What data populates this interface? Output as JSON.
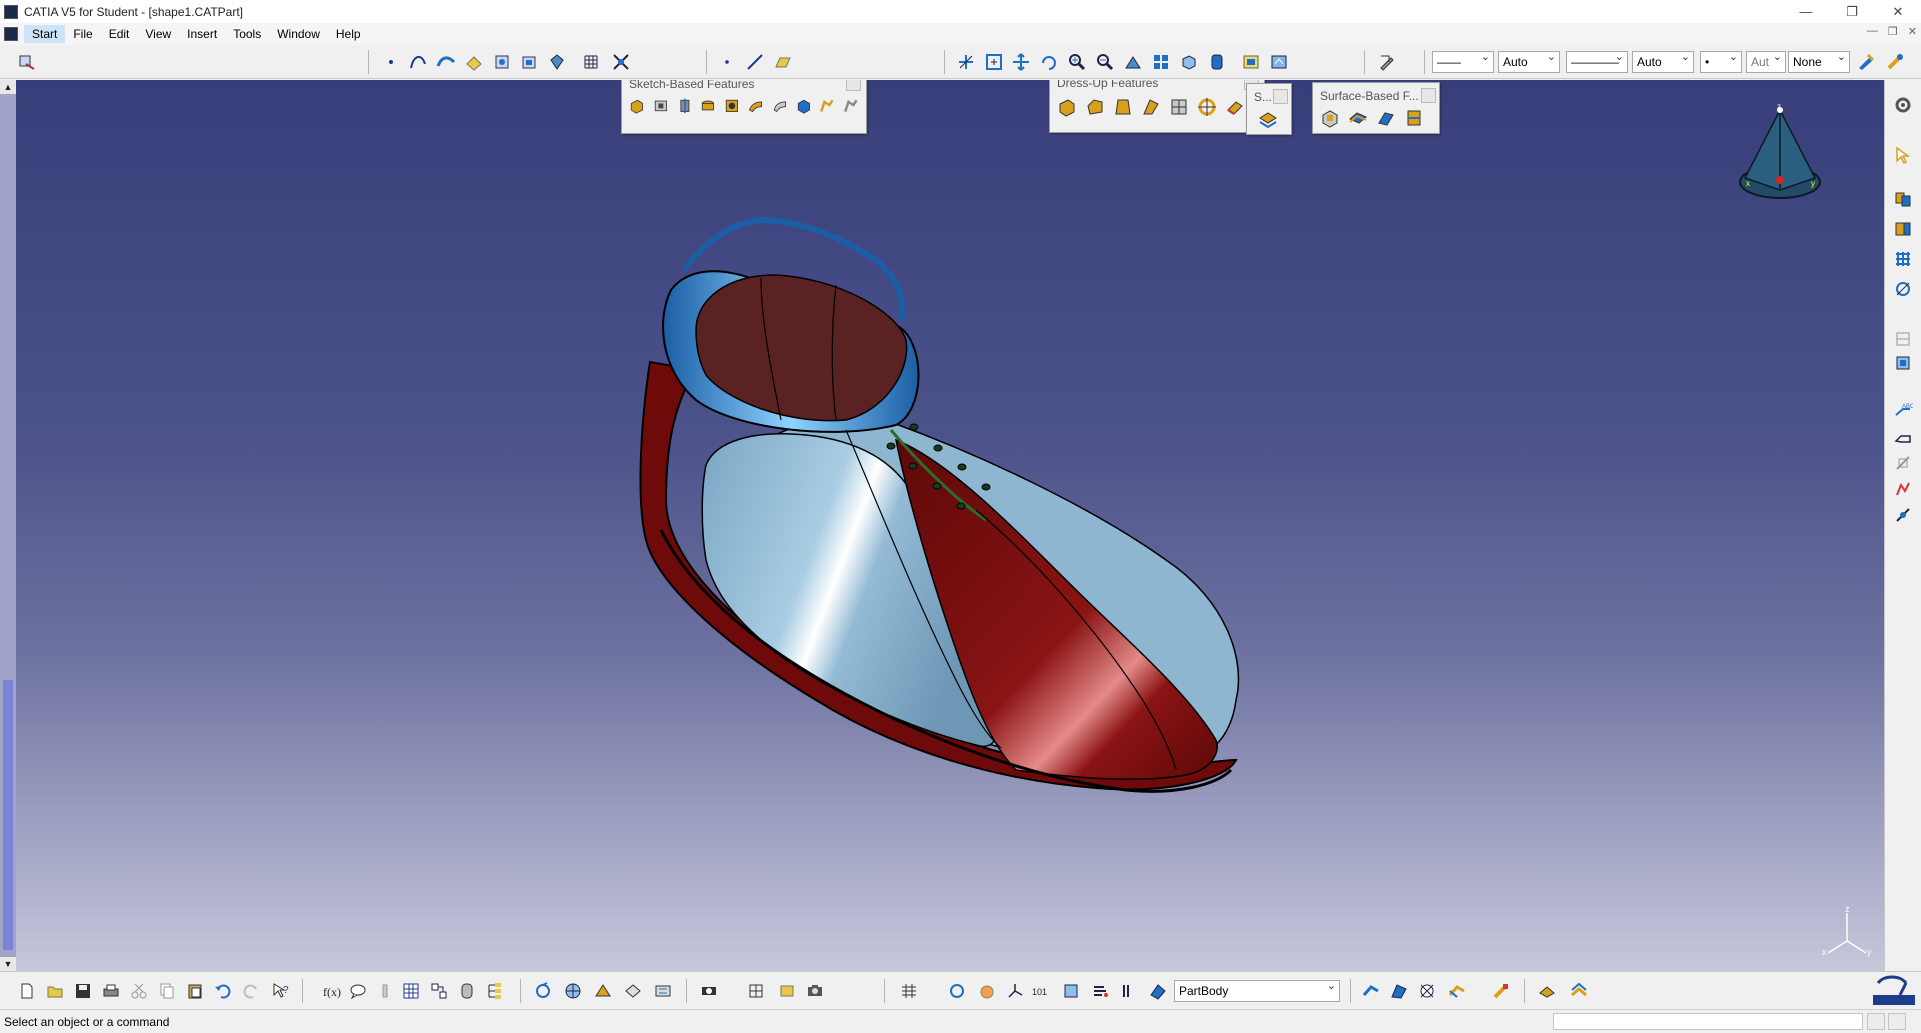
{
  "window": {
    "title": "CATIA V5 for Student - [shape1.CATPart]",
    "controls": [
      "—",
      "❐",
      "✕"
    ]
  },
  "menubar": {
    "items": [
      "Start",
      "File",
      "Edit",
      "View",
      "Insert",
      "Tools",
      "Window",
      "Help"
    ],
    "doc_controls": [
      "—",
      "❐",
      "✕"
    ]
  },
  "properties_toolbar": {
    "linetype_value": "——",
    "thickness_value": "Auto",
    "line_value": "————",
    "layer_value": "Auto",
    "point_value": "•",
    "aux_value": "Aut",
    "render_value": "None"
  },
  "floating_toolbars": {
    "sketch_based": {
      "title": "Sketch-Based Features"
    },
    "dress_up": {
      "title": "Dress-Up Features"
    },
    "s_small": {
      "title": "S..."
    },
    "surface_based": {
      "title": "Surface-Based F..."
    }
  },
  "compass": {
    "axes": [
      "x",
      "y",
      "z"
    ]
  },
  "axis_triad": {
    "labels": [
      "z",
      "x",
      "y"
    ]
  },
  "bottom_toolbar": {
    "body_selector_value": "PartBody"
  },
  "status": {
    "message": "Select an object or a command"
  },
  "colors": {
    "viewport_top": "#383e79",
    "viewport_bottom": "#c6c7db",
    "shoe_red": "#7a0d0d",
    "shoe_light_blue": "#8fb6d0",
    "shoe_collar_blue": "#2a86d2",
    "shoe_inner": "#5a2222"
  },
  "icons": {
    "top_toolbar": [
      "sketcher-icon",
      "point-icon",
      "spline-icon",
      "connect-curve-icon",
      "projection-icon",
      "3d-intersection-icon",
      "offset-icon",
      "compass-icon",
      "grid-icon",
      "snap-icon",
      "point-small-icon",
      "line-icon",
      "plane-icon",
      "fly-mode-icon",
      "fit-all-icon",
      "pan-icon",
      "rotate-icon",
      "zoom-in-icon",
      "zoom-out-icon",
      "normal-view-icon",
      "multi-view-icon",
      "iso-view-icon",
      "shading-icon",
      "hide-show-icon",
      "swap-space-icon",
      "apply-material-icon",
      "paint-icon"
    ],
    "right_toolbar": [
      "select-icon",
      "boolean-icon",
      "transformation-icon",
      "pattern-icon",
      "scale-icon",
      "reference-element-icon",
      "measure-icon",
      "annotation-icon",
      "text-icon",
      "constraint-icon",
      "analysis-icon",
      "draft-icon"
    ],
    "bottom_toolbar": [
      "new-icon",
      "open-icon",
      "save-icon",
      "print-icon",
      "cut-icon",
      "copy-icon",
      "paste-icon",
      "undo-icon",
      "redo-icon",
      "whats-this-icon",
      "formula-icon",
      "comment-icon",
      "knowledge-icon",
      "table-icon",
      "catalog-icon",
      "measure-item-icon",
      "analysis-icon",
      "tree-icon",
      "update-icon",
      "manipulation-icon",
      "apply-icon",
      "exit-icon",
      "repeat-icon",
      "link-icon",
      "camera-icon",
      "grid-icon",
      "refresh-icon",
      "pan-icon",
      "axis-icon",
      "view-mode-icon",
      "shading-icon",
      "layer-icon",
      "body-icon",
      "part-body-icon",
      "part-design-icon",
      "surface-icon",
      "shape-icon",
      "exit-workbench-icon"
    ]
  }
}
